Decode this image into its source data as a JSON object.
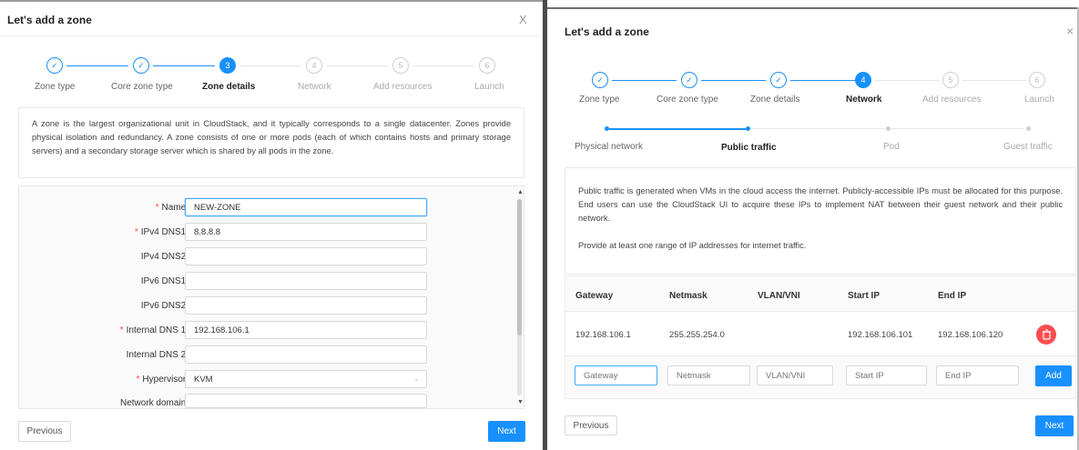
{
  "left": {
    "title": "Let's add a zone",
    "close": "X",
    "steps": [
      {
        "label": "Zone type",
        "num": "✓"
      },
      {
        "label": "Core zone type",
        "num": "✓"
      },
      {
        "label": "Zone details",
        "num": "3"
      },
      {
        "label": "Network",
        "num": "4"
      },
      {
        "label": "Add resources",
        "num": "5"
      },
      {
        "label": "Launch",
        "num": "6"
      }
    ],
    "description": "A zone is the largest organizational unit in CloudStack, and it typically corresponds to a single datacenter. Zones provide physical isolation and redundancy. A zone consists of one or more pods (each of which contains hosts and primary storage servers) and a secondary storage server which is shared by all pods in the zone.",
    "form": {
      "name_label": "Name:",
      "name_value": "NEW-ZONE",
      "ipv4dns1_label": "IPv4 DNS1:",
      "ipv4dns1_value": "8.8.8.8",
      "ipv4dns2_label": "IPv4 DNS2:",
      "ipv4dns2_value": "",
      "ipv6dns1_label": "IPv6 DNS1:",
      "ipv6dns1_value": "",
      "ipv6dns2_label": "IPv6 DNS2:",
      "ipv6dns2_value": "",
      "intdns1_label": "Internal DNS 1:",
      "intdns1_value": "192.168.106.1",
      "intdns2_label": "Internal DNS 2:",
      "intdns2_value": "",
      "hypervisor_label": "Hypervisor:",
      "hypervisor_value": "KVM",
      "netdomain_label": "Network domain:",
      "netdomain_value": ""
    },
    "prev_label": "Previous",
    "next_label": "Next"
  },
  "right": {
    "title": "Let's add a zone",
    "close": "×",
    "steps": [
      {
        "label": "Zone type",
        "num": "✓"
      },
      {
        "label": "Core zone type",
        "num": "✓"
      },
      {
        "label": "Zone details",
        "num": "✓"
      },
      {
        "label": "Network",
        "num": "4"
      },
      {
        "label": "Add resources",
        "num": "5"
      },
      {
        "label": "Launch",
        "num": "6"
      }
    ],
    "substeps": [
      {
        "label": "Physical network"
      },
      {
        "label": "Public traffic"
      },
      {
        "label": "Pod"
      },
      {
        "label": "Guest traffic"
      }
    ],
    "description": "Public traffic is generated when VMs in the cloud access the internet. Publicly-accessible IPs must be allocated for this purpose. End users can use the CloudStack UI to acquire these IPs to implement NAT between their guest network and their public network.",
    "description2": "Provide at least one range of IP addresses for internet traffic.",
    "table": {
      "headers": [
        "Gateway",
        "Netmask",
        "VLAN/VNI",
        "Start IP",
        "End IP"
      ],
      "row": {
        "gateway": "192.168.106.1",
        "netmask": "255.255.254.0",
        "vlan": "",
        "start": "192.168.106.101",
        "end": "192.168.106.120"
      },
      "placeholders": {
        "gateway": "Gateway",
        "netmask": "Netmask",
        "vlan": "VLAN/VNI",
        "start": "Start IP",
        "end": "End IP"
      },
      "add_label": "Add"
    },
    "prev_label": "Previous",
    "next_label": "Next"
  }
}
